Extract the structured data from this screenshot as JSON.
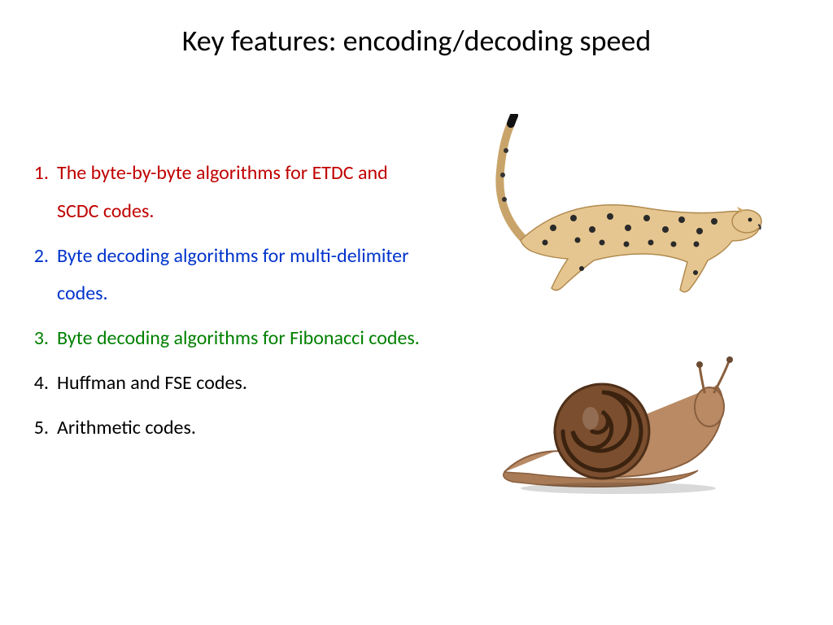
{
  "title": "Key features: encoding/decoding speed",
  "items": [
    {
      "num": "1.",
      "text": "The byte-by-byte algorithms for ETDC and SCDC codes.",
      "cls": "red"
    },
    {
      "num": "2.",
      "text": "Byte decoding algorithms for multi-delimiter codes.",
      "cls": "blue"
    },
    {
      "num": "3.",
      "text": "Byte decoding algorithms for Fibonacci codes.",
      "cls": "green"
    },
    {
      "num": "4.",
      "text": "Huffman and FSE codes.",
      "cls": "black"
    },
    {
      "num": "5.",
      "text": "Arithmetic codes.",
      "cls": "black"
    }
  ],
  "icons": {
    "fast": "cheetah-icon",
    "slow": "snail-icon"
  }
}
